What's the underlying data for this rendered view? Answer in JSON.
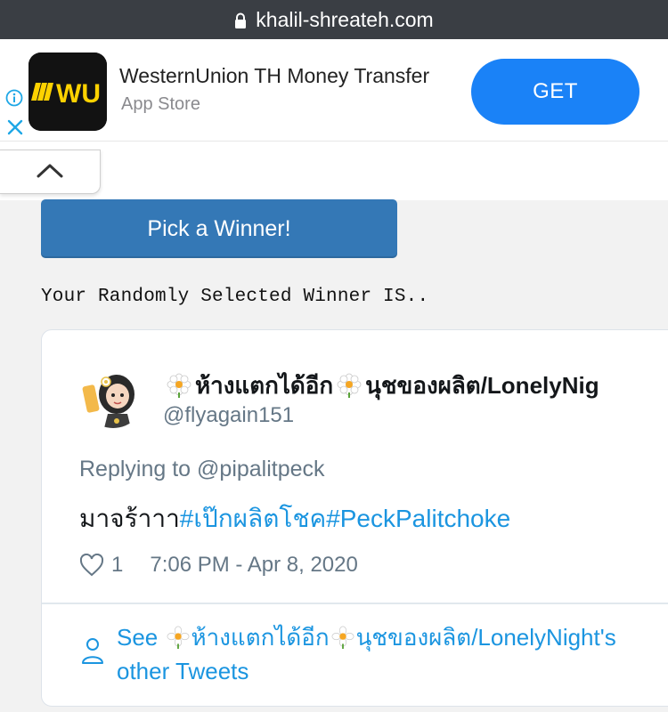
{
  "browser": {
    "url": "khalil-shreateh.com"
  },
  "ad": {
    "logo_text": "WU",
    "title": "WesternUnion TH Money Transfer",
    "subtitle": "App Store",
    "cta": "GET"
  },
  "content": {
    "pick_button": "Pick a Winner!",
    "winner_heading": "Your Randomly Selected Winner IS.."
  },
  "tweet": {
    "name_part1": "ห้างแตกได้อีก",
    "name_part2": "นุชของผลิต/LonelyNig",
    "handle": "@flyagain151",
    "replying_prefix": "Replying to",
    "replying_user": "@pipalitpeck",
    "text_plain": "มาจร้าาา",
    "hashtag1": "#เป๊กผลิตโชค",
    "hashtag2": "#PeckPalitchoke",
    "likes": "1",
    "timestamp": "7:06 PM - Apr 8, 2020",
    "see_prefix": "See",
    "see_name1": "ห้างแตกได้อีก",
    "see_name2": "นุชของผลิต/LonelyNight's",
    "see_suffix": "other Tweets"
  },
  "colors": {
    "get_button": "#1a82f7",
    "pick_button": "#3478b6",
    "twitter_link": "#1b95e0",
    "url_bar": "#3a3e44"
  }
}
